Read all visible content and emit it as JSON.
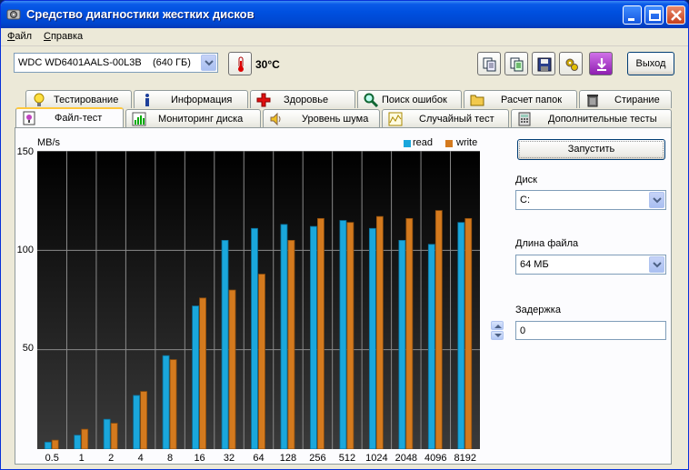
{
  "window": {
    "title": "Средство диагностики жестких дисков",
    "controls": [
      "minimize-icon",
      "maximize-icon",
      "close-icon"
    ]
  },
  "menu": [
    {
      "label": "Файл"
    },
    {
      "label": "Справка"
    }
  ],
  "toolbar": {
    "drive": "WDC WD6401AALS-00L3B    (640 ГБ)",
    "temperature": "30°C",
    "icons": [
      "copy-icon",
      "copy-all-icon",
      "save-icon",
      "options-icon",
      "download-icon"
    ],
    "exit_label": "Выход"
  },
  "tabs_row1": [
    {
      "label": "Тестирование",
      "icon": "info-bulb-icon"
    },
    {
      "label": "Информация",
      "icon": "info-icon"
    },
    {
      "label": "Здоровье",
      "icon": "health-cross-icon"
    },
    {
      "label": "Поиск ошибок",
      "icon": "magnifier-icon"
    },
    {
      "label": "Расчет папок",
      "icon": "folder-icon"
    },
    {
      "label": "Стирание",
      "icon": "trash-icon"
    }
  ],
  "tabs_row2": [
    {
      "label": "Файл-тест",
      "icon": "file-test-icon",
      "active": true
    },
    {
      "label": "Мониторинг диска",
      "icon": "monitor-chart-icon"
    },
    {
      "label": "Уровень шума",
      "icon": "speaker-icon"
    },
    {
      "label": "Случайный тест",
      "icon": "random-icon"
    },
    {
      "label": "Дополнительные тесты",
      "icon": "calculator-icon"
    }
  ],
  "controls": {
    "run_label": "Запустить",
    "disk_label": "Диск",
    "disk_value": "C:",
    "filesize_label": "Длина файла",
    "filesize_value": "64 МБ",
    "delay_label": "Задержка",
    "delay_value": "0"
  },
  "colors": {
    "read": "#1aa7dc",
    "write": "#d47a1e"
  },
  "chart_data": {
    "type": "bar",
    "ylabel": "MB/s",
    "ylim": [
      0,
      150
    ],
    "yticks": [
      50,
      100,
      150
    ],
    "grid": true,
    "legend": "top-right",
    "categories": [
      "0.5",
      "1",
      "2",
      "4",
      "8",
      "16",
      "32",
      "64",
      "128",
      "256",
      "512",
      "1024",
      "2048",
      "4096",
      "8192"
    ],
    "series": [
      {
        "name": "read",
        "values": [
          3.5,
          7,
          15,
          27,
          47,
          72,
          105,
          111,
          113,
          112,
          115,
          111,
          105,
          103,
          114
        ]
      },
      {
        "name": "write",
        "values": [
          4.5,
          10,
          13,
          29,
          45,
          76,
          80,
          88,
          105,
          116,
          114,
          117,
          116,
          120,
          116
        ]
      }
    ]
  }
}
